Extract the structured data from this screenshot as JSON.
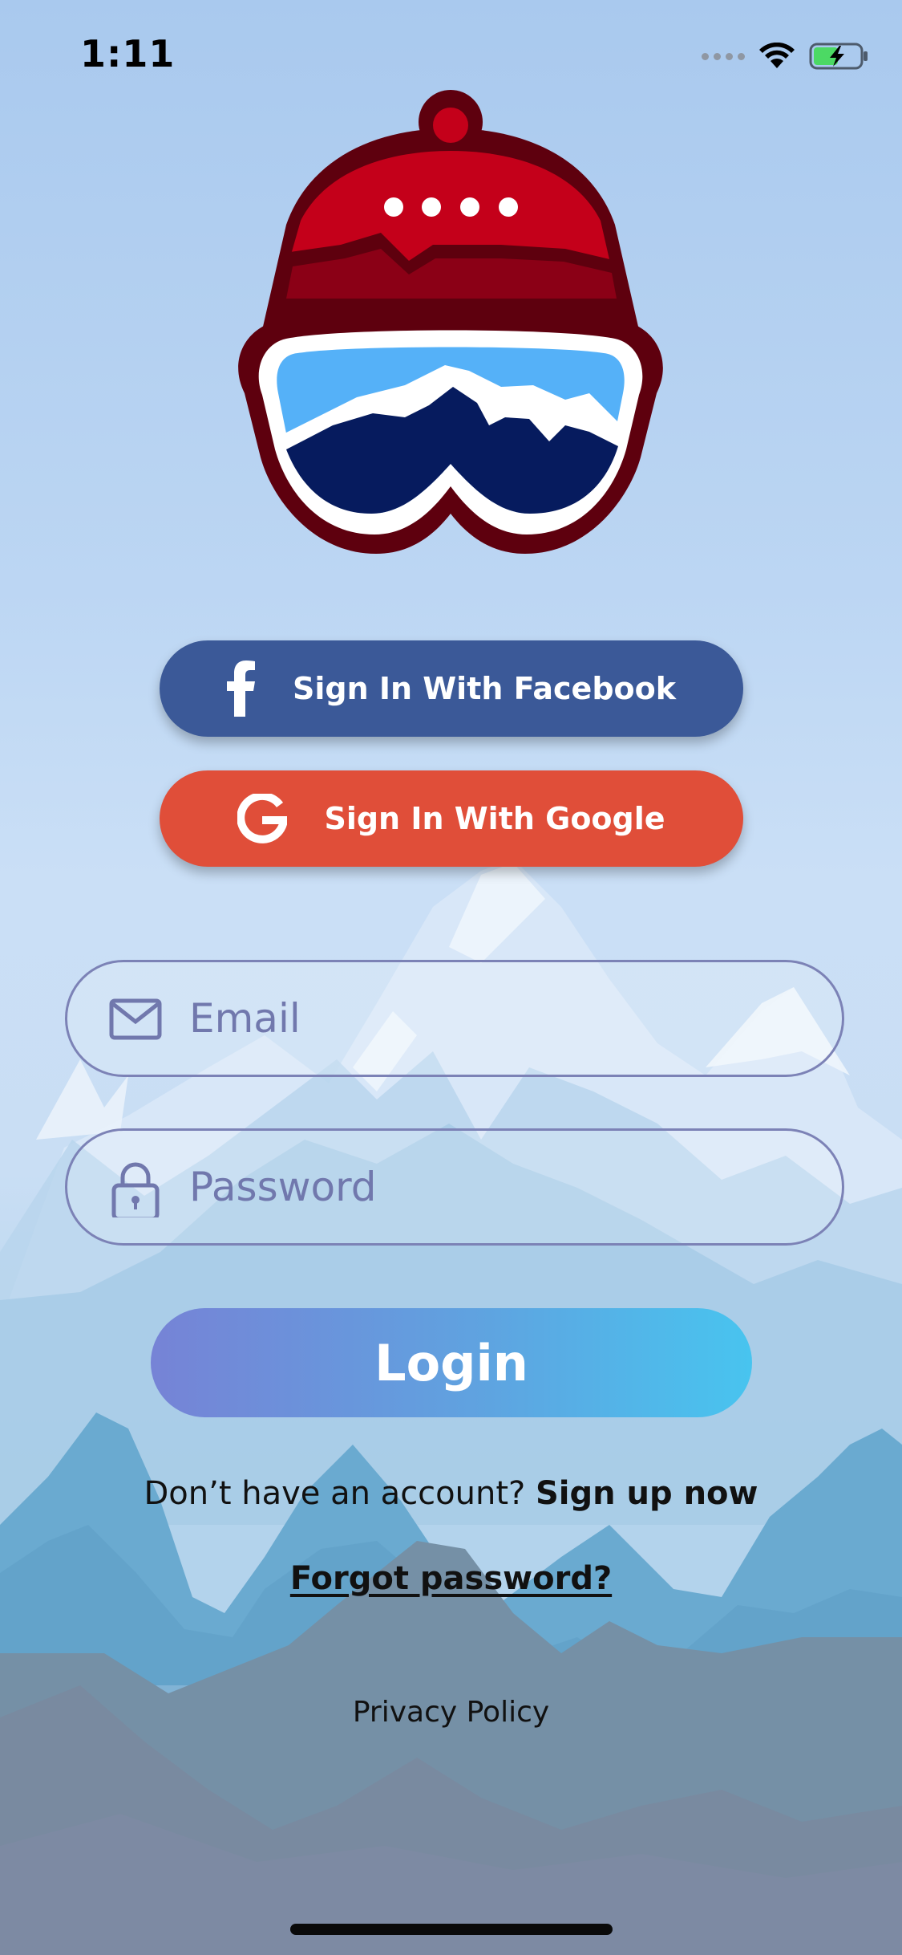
{
  "status_bar": {
    "time": "1:11",
    "icons": [
      "signal-dots-icon",
      "wifi-icon",
      "battery-charging-icon"
    ]
  },
  "logo": {
    "icon": "ski-beanie-goggles-logo",
    "colors": {
      "hat": "#c4001a",
      "hat_band": "#8b0016",
      "outline": "#5e000e",
      "goggle_sky": "#55b1f8",
      "goggle_mountain": "#061b5e"
    }
  },
  "social": {
    "facebook": {
      "label": "Sign In With Facebook",
      "icon": "facebook-icon",
      "color": "#3b5998"
    },
    "google": {
      "label": "Sign In With Google",
      "icon": "google-icon",
      "color": "#e04e39"
    }
  },
  "form": {
    "email": {
      "placeholder": "Email",
      "value": "",
      "icon": "mail-icon"
    },
    "password": {
      "placeholder": "Password",
      "value": "",
      "icon": "lock-icon"
    },
    "login_label": "Login"
  },
  "footer": {
    "signup_prompt": "Don’t have an account?",
    "signup_link": "Sign up now",
    "forgot_password": "Forgot password?",
    "privacy_policy": "Privacy Policy"
  },
  "theme": {
    "field_border": "#7c82b6",
    "login_gradient": [
      "#7683d6",
      "#48c4ef"
    ]
  }
}
